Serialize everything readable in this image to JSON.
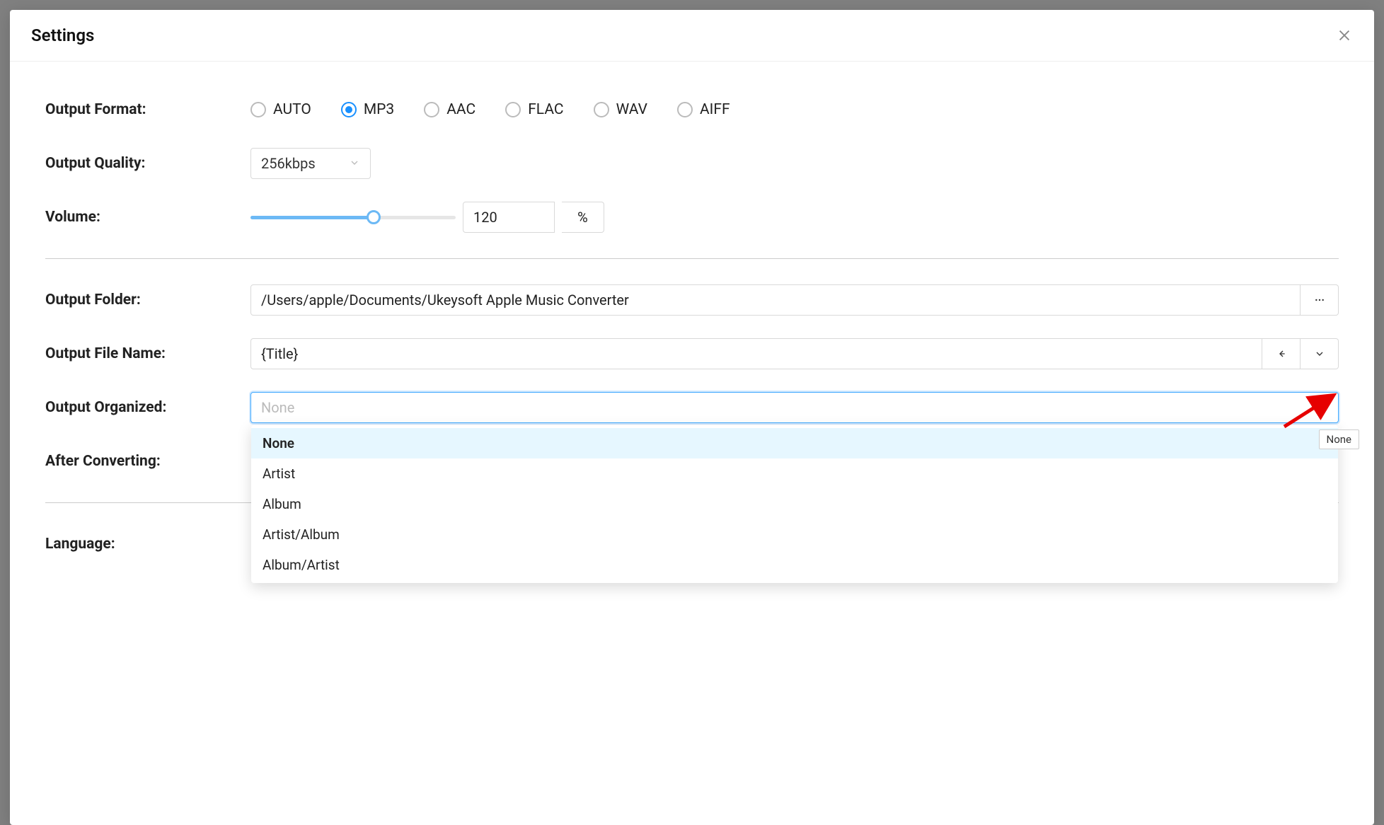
{
  "modal": {
    "title": "Settings"
  },
  "output_format": {
    "label": "Output Format:",
    "options": [
      "AUTO",
      "MP3",
      "AAC",
      "FLAC",
      "WAV",
      "AIFF"
    ],
    "selected": "MP3"
  },
  "output_quality": {
    "label": "Output Quality:",
    "value": "256kbps"
  },
  "volume": {
    "label": "Volume:",
    "value": "120",
    "percent": 60,
    "unit": "%"
  },
  "output_folder": {
    "label": "Output Folder:",
    "value": "/Users/apple/Documents/Ukeysoft Apple Music Converter"
  },
  "output_file_name": {
    "label": "Output File Name:",
    "value": "{Title}"
  },
  "output_organized": {
    "label": "Output Organized:",
    "placeholder": "None",
    "options": [
      "None",
      "Artist",
      "Album",
      "Artist/Album",
      "Album/Artist"
    ],
    "active": "None",
    "tooltip": "None"
  },
  "after_converting": {
    "label": "After Converting:"
  },
  "language": {
    "label": "Language:"
  }
}
